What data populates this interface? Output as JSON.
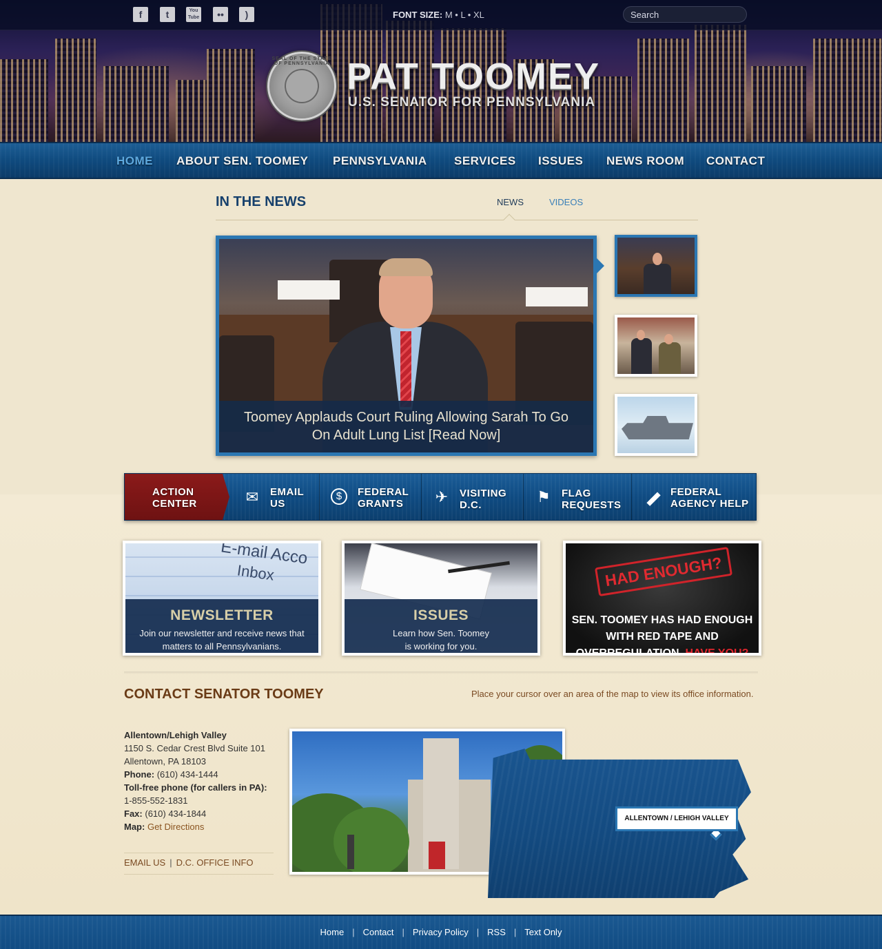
{
  "topbar": {
    "social_icons": [
      {
        "name": "facebook-icon",
        "glyph": "f"
      },
      {
        "name": "twitter-icon",
        "glyph": "t"
      },
      {
        "name": "youtube-icon",
        "glyph": "You Tube"
      },
      {
        "name": "flickr-icon",
        "glyph": "••"
      },
      {
        "name": "rss-icon",
        "glyph": ")"
      }
    ],
    "font_size_label": "FONT SIZE:",
    "font_size_options": "M • L • XL",
    "search_placeholder": "Search"
  },
  "header": {
    "title": "PAT TOOMEY",
    "subtitle": "U.S. SENATOR FOR PENNSYLVANIA",
    "seal_text": "SEAL OF THE STATE OF PENNSYLVANIA"
  },
  "nav": {
    "items": [
      {
        "label": "HOME",
        "active": true
      },
      {
        "label": "ABOUT SEN. TOOMEY",
        "active": false
      },
      {
        "label": "PENNSYLVANIA",
        "active": false
      },
      {
        "label": "SERVICES",
        "active": false
      },
      {
        "label": "ISSUES",
        "active": false
      },
      {
        "label": "NEWS ROOM",
        "active": false
      },
      {
        "label": "CONTACT",
        "active": false
      }
    ]
  },
  "news": {
    "title": "IN THE NEWS",
    "tabs": [
      "NEWS",
      "VIDEOS"
    ],
    "feature_caption": "Toomey Applauds Court Ruling Allowing Sarah To Go On Adult Lung List [Read Now]"
  },
  "action_bar": {
    "action_center": "ACTION\nCENTER",
    "items": [
      {
        "label_1": "EMAIL",
        "label_2": "US",
        "icon": "envelope-icon"
      },
      {
        "label_1": "FEDERAL",
        "label_2": "GRANTS",
        "icon": "dollar-icon"
      },
      {
        "label_1": "VISITING",
        "label_2": "D.C.",
        "icon": "airplane-icon"
      },
      {
        "label_1": "FLAG",
        "label_2": "REQUESTS",
        "icon": "flag-icon"
      },
      {
        "label_1": "FEDERAL",
        "label_2": "AGENCY HELP",
        "icon": "bandage-icon"
      }
    ]
  },
  "promos": {
    "newsletter": {
      "title": "NEWSLETTER",
      "text": "Join our newsletter and receive news that matters to all Pennsylvanians.",
      "bg_word_1": "E-mail Acco",
      "bg_word_2": "Inbox"
    },
    "issues": {
      "title": "ISSUES",
      "text": "Learn how Sen. Toomey is working for you."
    },
    "had_enough": {
      "stamp": "HAD ENOUGH?",
      "text": "SEN. TOOMEY HAS HAD ENOUGH WITH RED TAPE AND OVERREGULATION.",
      "cta": "HAVE YOU?"
    }
  },
  "contact": {
    "title": "CONTACT SENATOR TOOMEY",
    "map_hint": "Place your cursor over an area of the map to view its office information.",
    "office": {
      "name": "Allentown/Lehigh Valley",
      "address_1": "1150 S. Cedar Crest Blvd Suite 101",
      "address_2": "Allentown, PA 18103",
      "phone_label": "Phone:",
      "phone": "(610) 434-1444",
      "tollfree_label": "Toll-free phone (for callers in PA):",
      "tollfree": "1-855-552-1831",
      "fax_label": "Fax:",
      "fax": "(610) 434-1844",
      "map_label": "Map:",
      "map_link": "Get Directions"
    },
    "links": [
      "EMAIL US",
      "D.C. OFFICE INFO"
    ],
    "map_tooltip": "ALLENTOWN / LEHIGH VALLEY"
  },
  "footer": {
    "links": [
      "Home",
      "Contact",
      "Privacy Policy",
      "RSS",
      "Text Only"
    ]
  },
  "colors": {
    "nav_blue": "#0f4a7e",
    "accent_blue": "#2b77b3",
    "action_red": "#8b1a1a",
    "title_brown": "#6a3b16",
    "parchment": "#efe6cf"
  }
}
